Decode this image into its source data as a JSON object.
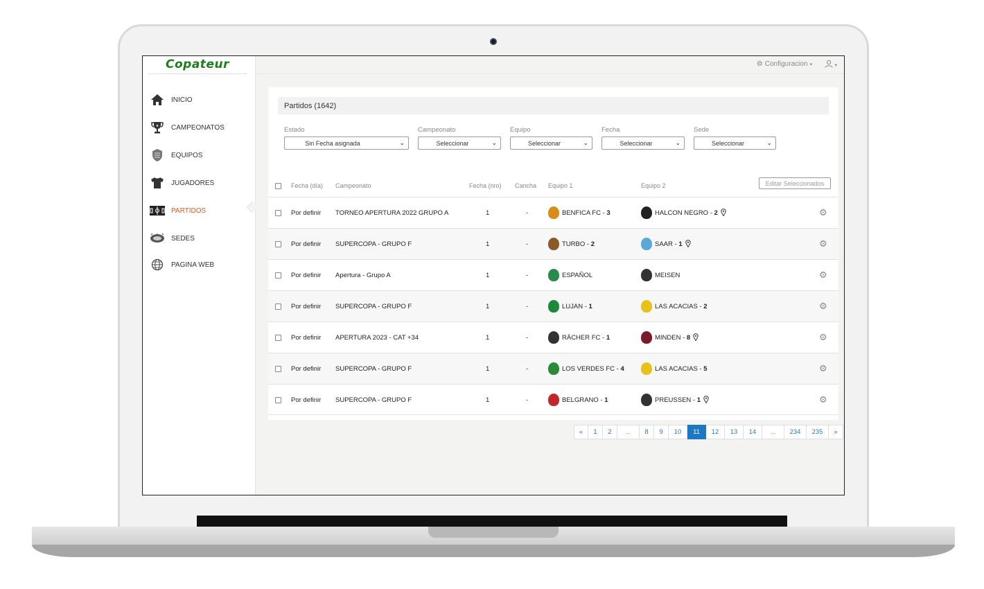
{
  "app": {
    "logo_text": "Copateur"
  },
  "sidebar": {
    "items": [
      {
        "label": "INICIO",
        "icon": "home-icon"
      },
      {
        "label": "CAMPEONATOS",
        "icon": "trophy-icon"
      },
      {
        "label": "EQUIPOS",
        "icon": "shield-icon"
      },
      {
        "label": "JUGADORES",
        "icon": "jersey-icon"
      },
      {
        "label": "PARTIDOS",
        "icon": "field-icon",
        "active": true
      },
      {
        "label": "SEDES",
        "icon": "stadium-icon"
      },
      {
        "label": "PAGINA WEB",
        "icon": "globe-icon"
      }
    ]
  },
  "topbar": {
    "config_label": "Configuracion",
    "config_icon": "gear-icon",
    "user_icon": "user-icon"
  },
  "panel": {
    "title": "Partidos (1642)"
  },
  "filters": {
    "estado": {
      "label": "Estado",
      "value": "Sin Fecha asignada"
    },
    "campeonato": {
      "label": "Campeonato",
      "value": "Seleccionar"
    },
    "equipo": {
      "label": "Equipo",
      "value": "Seleccionar"
    },
    "fecha": {
      "label": "Fecha",
      "value": "Seleccionar"
    },
    "sede": {
      "label": "Sede",
      "value": "Seleccionar"
    }
  },
  "table": {
    "headers": {
      "fecha_dia": "Fecha (día)",
      "campeonato": "Campeonato",
      "fecha_nro": "Fecha (nro)",
      "cancha": "Cancha",
      "equipo1": "Equipo 1",
      "equipo2": "Equipo 2"
    },
    "edit_selected_label": "Editar Seleccionados",
    "rows": [
      {
        "fecha": "Por definir",
        "campeonato": "TORNEO APERTURA 2022 GRUPO A",
        "nro": "1",
        "cancha": "-",
        "e1_name": "BENFICA FC - ",
        "e1_score": "3",
        "e2_name": "HALCON NEGRO - ",
        "e2_score": "2",
        "e2_pin": true
      },
      {
        "fecha": "Por definir",
        "campeonato": "SUPERCOPA - GRUPO F",
        "nro": "1",
        "cancha": "-",
        "e1_name": "TURBO - ",
        "e1_score": "2",
        "e2_name": "SAAR - ",
        "e2_score": "1",
        "e2_pin": true
      },
      {
        "fecha": "Por definir",
        "campeonato": "Apertura - Grupo A",
        "nro": "1",
        "cancha": "-",
        "e1_name": "ESPAÑOL",
        "e1_score": "",
        "e2_name": "MEISEN",
        "e2_score": "",
        "e2_pin": false
      },
      {
        "fecha": "Por definir",
        "campeonato": "SUPERCOPA - GRUPO F",
        "nro": "1",
        "cancha": "-",
        "e1_name": "LUJAN - ",
        "e1_score": "1",
        "e2_name": "LAS ACACIAS - ",
        "e2_score": "2",
        "e2_pin": false
      },
      {
        "fecha": "Por definir",
        "campeonato": "APERTURA 2023 - CAT +34",
        "nro": "1",
        "cancha": "-",
        "e1_name": "RÄCHER FC - ",
        "e1_score": "1",
        "e2_name": "MINDEN - ",
        "e2_score": "8",
        "e2_pin": true
      },
      {
        "fecha": "Por definir",
        "campeonato": "SUPERCOPA - GRUPO F",
        "nro": "1",
        "cancha": "-",
        "e1_name": "LOS VERDES FC - ",
        "e1_score": "4",
        "e2_name": "LAS ACACIAS - ",
        "e2_score": "5",
        "e2_pin": false
      },
      {
        "fecha": "Por definir",
        "campeonato": "SUPERCOPA - GRUPO F",
        "nro": "1",
        "cancha": "-",
        "e1_name": "BELGRANO - ",
        "e1_score": "1",
        "e2_name": "PREUSSEN - ",
        "e2_score": "1",
        "e2_pin": true
      }
    ]
  },
  "pagination": {
    "pages": [
      "«",
      "1",
      "2",
      "...",
      "8",
      "9",
      "10",
      "11",
      "12",
      "13",
      "14",
      "...",
      "234",
      "235",
      "»"
    ],
    "current": "11"
  },
  "colors": {
    "brand_green": "#1a7f1a",
    "active_nav": "#e4571c",
    "pager_active": "#1b78c2"
  }
}
